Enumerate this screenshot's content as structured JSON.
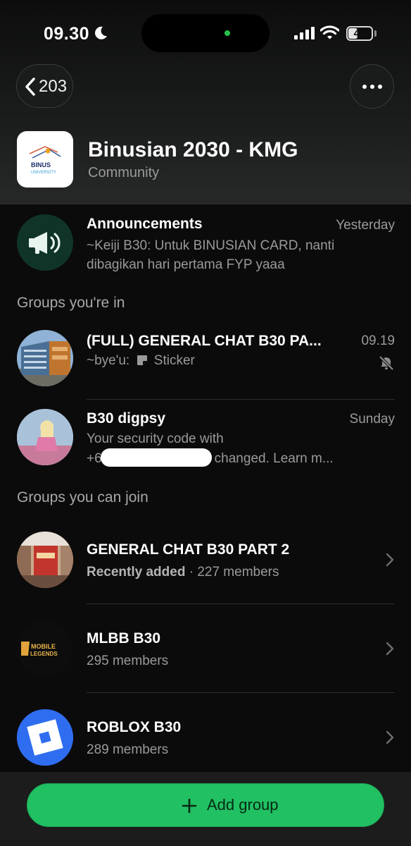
{
  "status_bar": {
    "time": "09.30",
    "battery": "40",
    "battery_percent": 40
  },
  "nav": {
    "back_count": "203"
  },
  "community": {
    "name": "Binusian 2030 - KMG",
    "type": "Community",
    "logo_text_1": "BINUS",
    "logo_text_2": "UNIVERSITY"
  },
  "announcements": {
    "title": "Announcements",
    "time": "Yesterday",
    "sender": "~Keiji B30:",
    "message_1": "Untuk BINUSIAN CARD, nanti",
    "message_2": "dibagikan hari pertama FYP yaaa"
  },
  "sections": {
    "groups_in": "Groups you're in",
    "groups_join": "Groups you can join"
  },
  "groups_in": [
    {
      "name": "(FULL) GENERAL CHAT B30 PA...",
      "time": "09.19",
      "sender": "~bye'u:",
      "message": "Sticker",
      "muted": true
    },
    {
      "name": "B30 digpsy",
      "time": "Sunday",
      "message_1": "Your security code with",
      "message_2_prefix": "+6",
      "message_2_suffix": "changed. Learn m..."
    }
  ],
  "groups_join": [
    {
      "name": "GENERAL CHAT B30 PART 2",
      "tag": "Recently added",
      "separator": "·",
      "members": "227 members"
    },
    {
      "name": "MLBB B30",
      "members": "295 members",
      "logo_text": "MOBILE LEGENDS"
    },
    {
      "name": "ROBLOX B30",
      "members": "289 members"
    }
  ],
  "bottom": {
    "add_group": "Add group"
  },
  "colors": {
    "accent": "#21c063",
    "background": "#0b0b0b",
    "announcement_avatar": "#103528",
    "roblox_blue": "#2f6df0"
  },
  "icons": [
    "moon-icon",
    "signal-icon",
    "wifi-icon",
    "battery-icon",
    "chevron-left-icon",
    "more-horizontal-icon",
    "megaphone-icon",
    "sticker-icon",
    "bell-off-icon",
    "chevron-right-icon",
    "plus-icon"
  ]
}
